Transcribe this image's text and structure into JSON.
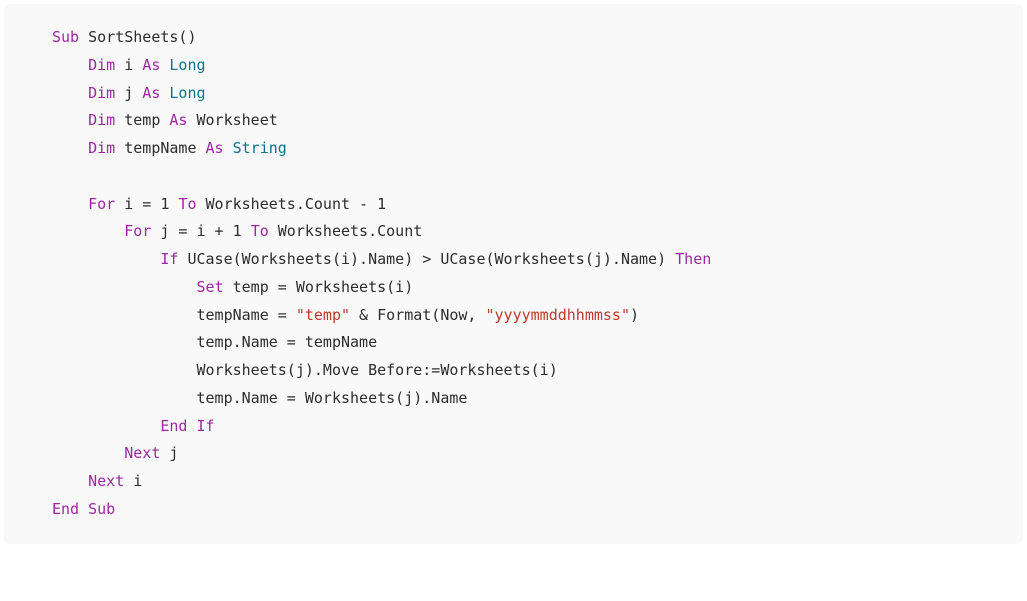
{
  "code": {
    "lines": [
      {
        "indent": 0,
        "tokens": [
          {
            "t": "Sub",
            "c": "kw"
          },
          {
            "t": " SortSheets()",
            "c": "ident"
          }
        ]
      },
      {
        "indent": 1,
        "tokens": [
          {
            "t": "Dim",
            "c": "kw"
          },
          {
            "t": " i ",
            "c": "ident"
          },
          {
            "t": "As",
            "c": "kw"
          },
          {
            "t": " ",
            "c": "ident"
          },
          {
            "t": "Long",
            "c": "type"
          }
        ]
      },
      {
        "indent": 1,
        "tokens": [
          {
            "t": "Dim",
            "c": "kw"
          },
          {
            "t": " j ",
            "c": "ident"
          },
          {
            "t": "As",
            "c": "kw"
          },
          {
            "t": " ",
            "c": "ident"
          },
          {
            "t": "Long",
            "c": "type"
          }
        ]
      },
      {
        "indent": 1,
        "tokens": [
          {
            "t": "Dim",
            "c": "kw"
          },
          {
            "t": " temp ",
            "c": "ident"
          },
          {
            "t": "As",
            "c": "kw"
          },
          {
            "t": " Worksheet",
            "c": "ident"
          }
        ]
      },
      {
        "indent": 1,
        "tokens": [
          {
            "t": "Dim",
            "c": "kw"
          },
          {
            "t": " tempName ",
            "c": "ident"
          },
          {
            "t": "As",
            "c": "kw"
          },
          {
            "t": " ",
            "c": "ident"
          },
          {
            "t": "String",
            "c": "type"
          }
        ]
      },
      {
        "indent": 0,
        "tokens": []
      },
      {
        "indent": 1,
        "tokens": [
          {
            "t": "For",
            "c": "kw"
          },
          {
            "t": " i = ",
            "c": "ident"
          },
          {
            "t": "1",
            "c": "num"
          },
          {
            "t": " ",
            "c": "ident"
          },
          {
            "t": "To",
            "c": "kw"
          },
          {
            "t": " Worksheets.Count - ",
            "c": "ident"
          },
          {
            "t": "1",
            "c": "num"
          }
        ]
      },
      {
        "indent": 2,
        "tokens": [
          {
            "t": "For",
            "c": "kw"
          },
          {
            "t": " j = i + ",
            "c": "ident"
          },
          {
            "t": "1",
            "c": "num"
          },
          {
            "t": " ",
            "c": "ident"
          },
          {
            "t": "To",
            "c": "kw"
          },
          {
            "t": " Worksheets.Count",
            "c": "ident"
          }
        ]
      },
      {
        "indent": 3,
        "tokens": [
          {
            "t": "If",
            "c": "kw"
          },
          {
            "t": " UCase(Worksheets(i).Name) > UCase(Worksheets(j).Name) ",
            "c": "ident"
          },
          {
            "t": "Then",
            "c": "kw"
          }
        ]
      },
      {
        "indent": 4,
        "tokens": [
          {
            "t": "Set",
            "c": "kw"
          },
          {
            "t": " temp = Worksheets(i)",
            "c": "ident"
          }
        ]
      },
      {
        "indent": 4,
        "tokens": [
          {
            "t": "tempName = ",
            "c": "ident"
          },
          {
            "t": "\"temp\"",
            "c": "str"
          },
          {
            "t": " & Format(Now, ",
            "c": "ident"
          },
          {
            "t": "\"yyyymmddhhmmss\"",
            "c": "str"
          },
          {
            "t": ")",
            "c": "ident"
          }
        ]
      },
      {
        "indent": 4,
        "tokens": [
          {
            "t": "temp.Name = tempName",
            "c": "ident"
          }
        ]
      },
      {
        "indent": 4,
        "tokens": [
          {
            "t": "Worksheets(j).Move Before:=Worksheets(i)",
            "c": "ident"
          }
        ]
      },
      {
        "indent": 4,
        "tokens": [
          {
            "t": "temp.Name = Worksheets(j).Name",
            "c": "ident"
          }
        ]
      },
      {
        "indent": 3,
        "tokens": [
          {
            "t": "End",
            "c": "kw"
          },
          {
            "t": " ",
            "c": "ident"
          },
          {
            "t": "If",
            "c": "kw"
          }
        ]
      },
      {
        "indent": 2,
        "tokens": [
          {
            "t": "Next",
            "c": "kw"
          },
          {
            "t": " j",
            "c": "ident"
          }
        ]
      },
      {
        "indent": 1,
        "tokens": [
          {
            "t": "Next",
            "c": "kw"
          },
          {
            "t": " i",
            "c": "ident"
          }
        ]
      },
      {
        "indent": 0,
        "tokens": [
          {
            "t": "End",
            "c": "kw"
          },
          {
            "t": " ",
            "c": "ident"
          },
          {
            "t": "Sub",
            "c": "kw"
          }
        ]
      }
    ],
    "indent_unit": "    "
  }
}
